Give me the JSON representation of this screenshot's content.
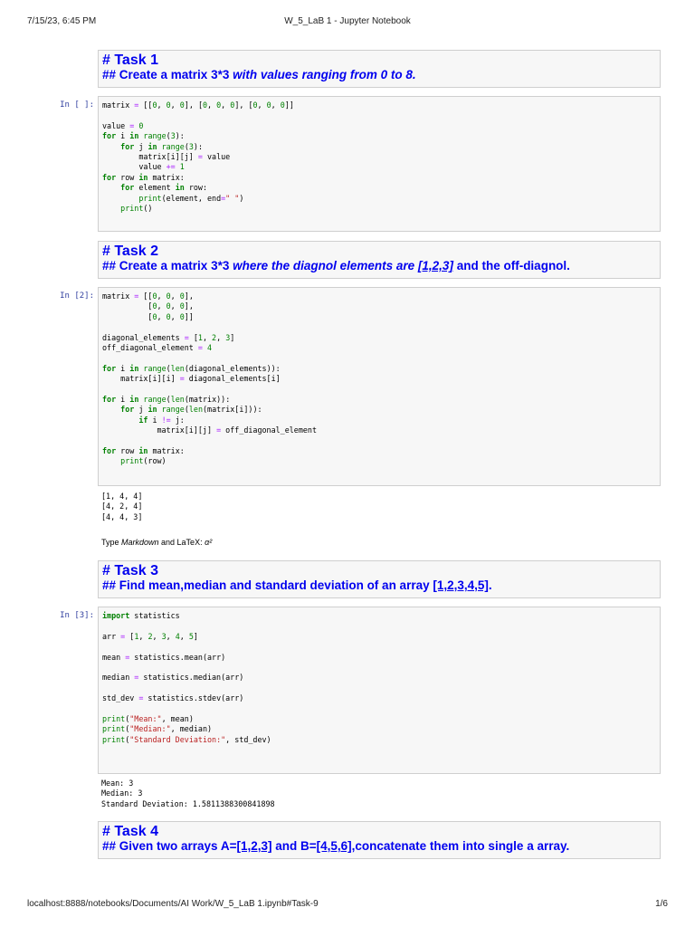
{
  "header": {
    "datetime": "7/15/23, 6:45 PM",
    "title": "W_5_LaB 1 - Jupyter Notebook"
  },
  "footer": {
    "url": "localhost:8888/notebooks/Documents/AI Work/W_5_LaB 1.ipynb#Task-9",
    "page": "1/6"
  },
  "cells": {
    "task1": {
      "h1": "# Task 1",
      "h2": "## Create a matrix 3*3 with values ranging from 0 to 8."
    },
    "code1": {
      "prompt": "In [ ]:",
      "lines": [
        "matrix = [[0, 0, 0], [0, 0, 0], [0, 0, 0]]",
        "",
        "value = 0",
        "for i in range(3):",
        "    for j in range(3):",
        "        matrix[i][j] = value",
        "        value += 1",
        "for row in matrix:",
        "    for element in row:",
        "        print(element, end=\" \")",
        "    print()",
        ""
      ]
    },
    "task2": {
      "h1": "# Task 2",
      "h2_prefix": "## Create a matrix 3*3 ",
      "h2_italic": "where the diagnol elements are ",
      "h2_link": "[1,2,3]",
      "h2_suffix": " and the off-diagnol."
    },
    "code2": {
      "prompt": "In [2]:",
      "lines": [
        "matrix = [[0, 0, 0],",
        "          [0, 0, 0],",
        "          [0, 0, 0]]",
        "",
        "diagonal_elements = [1, 2, 3]",
        "off_diagonal_element = 4",
        "",
        "for i in range(len(diagonal_elements)):",
        "    matrix[i][i] = diagonal_elements[i]",
        "",
        "for i in range(len(matrix)):",
        "    for j in range(len(matrix[i])):",
        "        if i != j:",
        "            matrix[i][j] = off_diagonal_element",
        "",
        "for row in matrix:",
        "    print(row)",
        ""
      ],
      "output": "[1, 4, 4]\n[4, 2, 4]\n[4, 4, 3]"
    },
    "rendered_md": {
      "prefix": "Type ",
      "italic": "Markdown",
      "suffix": " and LaTeX: ",
      "math": "α²"
    },
    "task3": {
      "h1": "# Task 3",
      "h2_prefix": "## Find mean,median and standard deviation of an array ",
      "h2_link": "[1,2,3,4,5]",
      "h2_suffix": "."
    },
    "code3": {
      "prompt": "In [3]:",
      "lines": [
        "import statistics",
        "",
        "arr = [1, 2, 3, 4, 5]",
        "",
        "mean = statistics.mean(arr)",
        "",
        "median = statistics.median(arr)",
        "",
        "std_dev = statistics.stdev(arr)",
        "",
        "print(\"Mean:\", mean)",
        "print(\"Median:\", median)",
        "print(\"Standard Deviation:\", std_dev)",
        "",
        "",
        ""
      ],
      "output": "Mean: 3\nMedian: 3\nStandard Deviation: 1.5811388300841898"
    },
    "task4": {
      "h1": "# Task 4",
      "h2_prefix": "## Given two arrays A=",
      "h2_link1": "[1,2,3]",
      "h2_mid": " and B=",
      "h2_link2": "[4,5,6]",
      "h2_suffix": ",concatenate them into single a array."
    }
  }
}
